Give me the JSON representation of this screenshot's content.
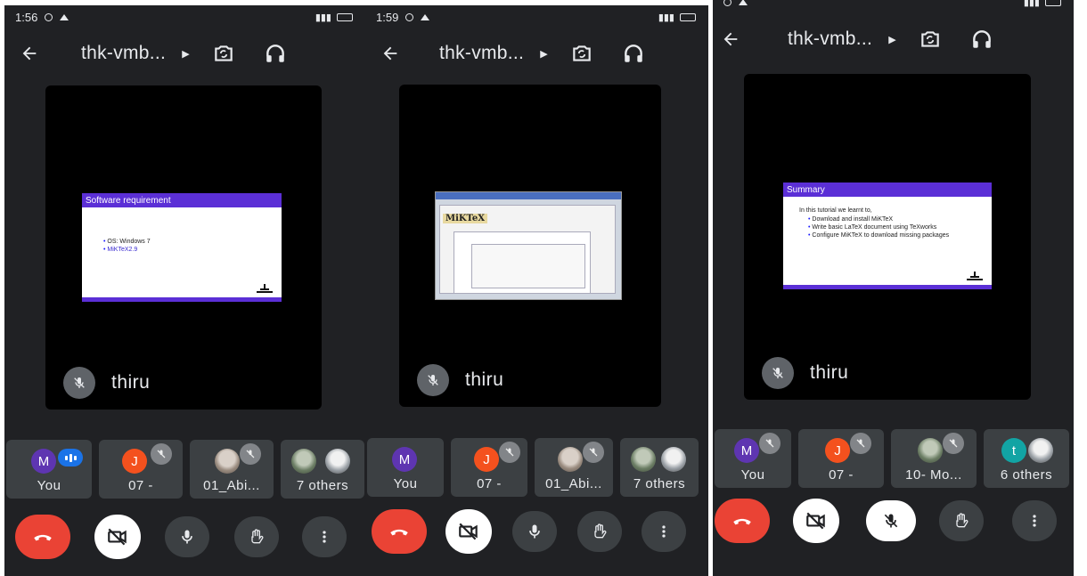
{
  "colors": {
    "background": "#202124",
    "tile": "#3c4043",
    "end_call": "#ea4335",
    "slide_header": "#5b2fd6",
    "speaking": "#1a73e8"
  },
  "screens": [
    {
      "status_time": "1:56",
      "meeting_title": "thk-vmb...",
      "slide": {
        "heading": "Software requirement",
        "bullets": [
          "OS: Windows 7",
          "MiKTeX2.9"
        ]
      },
      "presenter": "thiru",
      "participants": [
        {
          "initial": "M",
          "label": "You"
        },
        {
          "initial": "J",
          "label": "07 -"
        },
        {
          "initial": "",
          "label": "01_Abi..."
        },
        {
          "initial": "",
          "label": "7 others"
        }
      ]
    },
    {
      "status_time": "1:59",
      "meeting_title": "thk-vmb...",
      "slide": {
        "heading": "MiKTeX"
      },
      "presenter": "thiru",
      "participants": [
        {
          "initial": "M",
          "label": "You"
        },
        {
          "initial": "J",
          "label": "07 -"
        },
        {
          "initial": "",
          "label": "01_Abi..."
        },
        {
          "initial": "",
          "label": "7 others"
        }
      ]
    },
    {
      "meeting_title": "thk-vmb...",
      "slide": {
        "heading": "Summary",
        "intro": "In this tutorial we learnt to,",
        "bullets": [
          "Download and install MiKTeX",
          "Write basic LaTeX document using TeXworks",
          "Configure MiKTeX to download missing packages"
        ]
      },
      "presenter": "thiru",
      "participants": [
        {
          "initial": "M",
          "label": "You"
        },
        {
          "initial": "J",
          "label": "07 -"
        },
        {
          "initial": "",
          "label": "10- Mo..."
        },
        {
          "initial": "t",
          "label": "6 others"
        }
      ]
    }
  ],
  "icons": {
    "back": "arrow-left-icon",
    "more_menu": "caret-right-icon",
    "switch_camera": "switch-camera-icon",
    "audio": "headphones-icon",
    "mic_off": "mic-off-icon",
    "end_call": "call-end-icon",
    "camera_off": "videocam-off-icon",
    "mic": "mic-icon",
    "raise_hand": "hand-icon",
    "more": "more-vert-icon"
  }
}
